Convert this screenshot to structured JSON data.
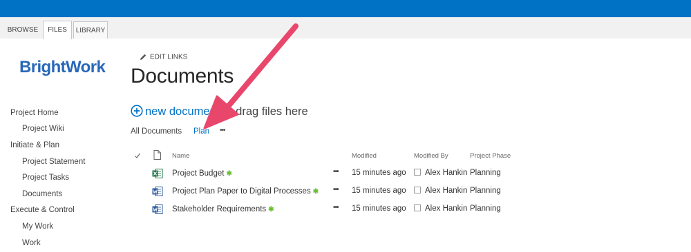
{
  "ribbon": {
    "tabs": [
      "BROWSE",
      "FILES",
      "LIBRARY"
    ],
    "active_tab": "FILES"
  },
  "logo": {
    "text": "BrightWork"
  },
  "quicklaunch": {
    "items": [
      {
        "label": "Project Home"
      },
      {
        "label": "Project Wiki"
      },
      {
        "label": "Initiate & Plan"
      },
      {
        "label": "Project Statement"
      },
      {
        "label": "Project Tasks"
      },
      {
        "label": "Documents"
      },
      {
        "label": "Execute & Control"
      },
      {
        "label": "My Work"
      },
      {
        "label": "Work"
      }
    ]
  },
  "edit_links": "EDIT LINKS",
  "page_title": "Documents",
  "new_document": {
    "link_text": "new document",
    "suffix": " or drag files here"
  },
  "views": {
    "all": "All Documents",
    "plan": "Plan",
    "more": "•••"
  },
  "columns": {
    "name": "Name",
    "modified": "Modified",
    "modified_by": "Modified By",
    "phase": "Project Phase"
  },
  "documents": [
    {
      "name": "Project Budget",
      "icon": "excel-icon",
      "modified": "15 minutes ago",
      "modified_by": "Alex Hankin",
      "phase": "Planning",
      "new_marker": "✱"
    },
    {
      "name": "Project Plan Paper to Digital Processes",
      "icon": "word-icon",
      "modified": "15 minutes ago",
      "modified_by": "Alex Hankin",
      "phase": "Planning",
      "new_marker": "✱"
    },
    {
      "name": "Stakeholder Requirements",
      "icon": "word-icon",
      "modified": "15 minutes ago",
      "modified_by": "Alex Hankin",
      "phase": "Planning",
      "new_marker": "✱"
    }
  ],
  "row_menu": "•••",
  "colors": {
    "suite_bar": "#0072c6",
    "link": "#0072c6",
    "arrow": "#e8476b",
    "logo": "#2768b8"
  }
}
